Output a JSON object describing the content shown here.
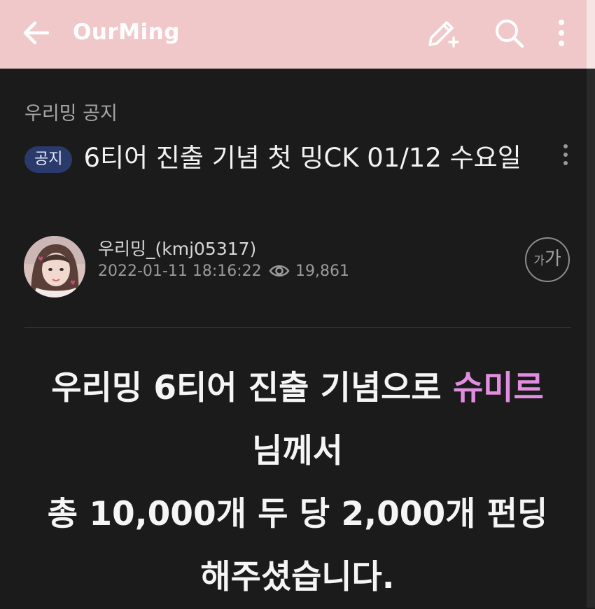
{
  "header": {
    "title": "OurMing",
    "icons": [
      "back-arrow-icon",
      "edit-icon",
      "search-icon",
      "more-vertical-icon"
    ]
  },
  "post": {
    "board": "우리밍 공지",
    "badge": "공지",
    "title": "6티어 진출 기념 첫 밍CK 01/12 수요일",
    "author": "우리밍_(kmj05317)",
    "date": "2022-01-11 18:16:22",
    "views": "19,861",
    "font_btn_small": "가",
    "font_btn_big": "가"
  },
  "body": {
    "line1_prefix": "우리밍 6티어 진출 기념으로 ",
    "line1_highlight": "슈미르",
    "line2": "님께서",
    "line3": "총 10,000개  두 당 2,000개 펀딩",
    "line4": "해주셨습니다."
  },
  "colors": {
    "header_bg": "#f1c8c9",
    "page_bg": "#1b1b1c",
    "badge_bg": "#2a3b6b",
    "highlight": "#e28ee0"
  }
}
